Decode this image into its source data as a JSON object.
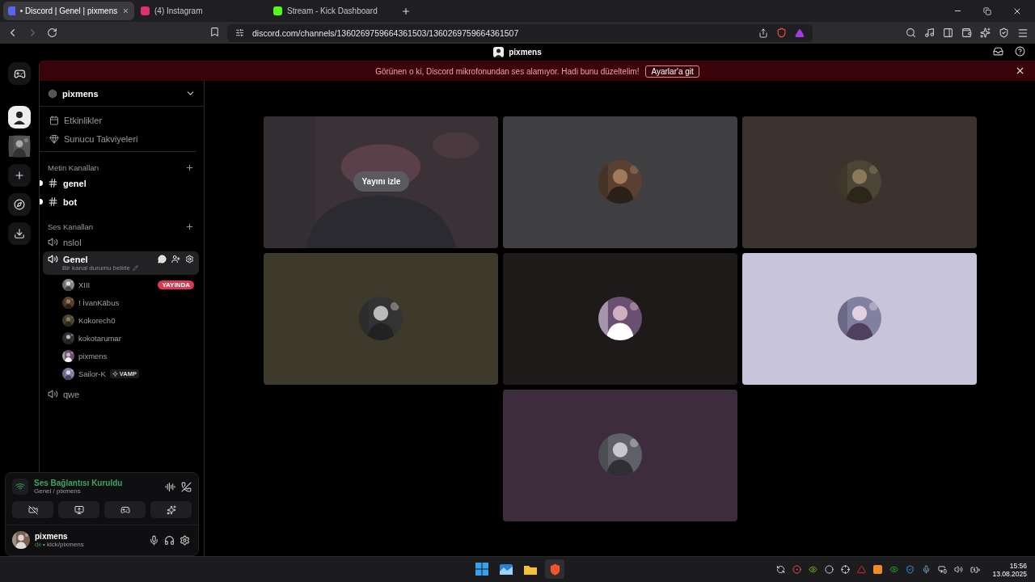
{
  "browser": {
    "tabs": [
      {
        "label": "• Discord | Genel | pixmens",
        "selected": true,
        "color": "#5865f2"
      },
      {
        "label": "(4) Instagram",
        "selected": false,
        "color": "#e1306c"
      },
      {
        "label": "Stream - Kick Dashboard",
        "selected": false,
        "color": "#53fc18"
      }
    ],
    "url": "discord.com/channels/1360269759664361503/1360269759664361507"
  },
  "discord": {
    "title": "pixmens",
    "banner": {
      "message": "Görünen o ki, Discord mikrofonundan ses alamıyor. Hadi bunu düzeltelim!",
      "action": "Ayarlar'a git"
    },
    "server": {
      "name": "pixmens",
      "links": [
        {
          "kind": "events",
          "label": "Etkinlikler"
        },
        {
          "kind": "boosts",
          "label": "Sunucu Takviyeleri"
        }
      ],
      "categories": [
        {
          "name": "Metin Kanalları",
          "channels": [
            {
              "kind": "text",
              "name": "genel",
              "unread": true
            },
            {
              "kind": "text",
              "name": "bot",
              "unread": true
            }
          ]
        },
        {
          "name": "Ses Kanalları",
          "channels": [
            {
              "kind": "voice",
              "name": "nslol",
              "selected": false
            },
            {
              "kind": "voice",
              "name": "Genel",
              "selected": true,
              "status": "Bir kanal durumu belirle",
              "members": [
                {
                  "name": "XIII",
                  "badge": "YAYINDA"
                },
                {
                  "name": "! İvanKābus"
                },
                {
                  "name": "Kokorech0"
                },
                {
                  "name": "kokotarumar"
                },
                {
                  "name": "pixmens"
                },
                {
                  "name": "Sailor-K",
                  "tag": "VAMP"
                }
              ]
            },
            {
              "kind": "voice",
              "name": "qwe",
              "selected": false
            }
          ]
        }
      ]
    },
    "voice": {
      "status": "Ses Bağlantısı Kuruldu",
      "location": "Genel / pixmens"
    },
    "user": {
      "name": "pixmens",
      "activity": "• kick/pixmens"
    },
    "tiles": [
      {
        "kind": "stream",
        "action": "Yayını izle"
      },
      {
        "kind": "avatar",
        "color": "#3f3f41"
      },
      {
        "kind": "avatar",
        "color": "#3d322d"
      },
      {
        "kind": "avatar",
        "color": "#3d3a2c"
      },
      {
        "kind": "avatar",
        "color": "#1e1a1a"
      },
      {
        "kind": "avatar",
        "color": "#c8c5db"
      },
      {
        "kind": "avatar",
        "color": "#3d2b3e"
      }
    ]
  },
  "taskbar": {
    "time": "15:56",
    "date": "13.08.2025"
  }
}
